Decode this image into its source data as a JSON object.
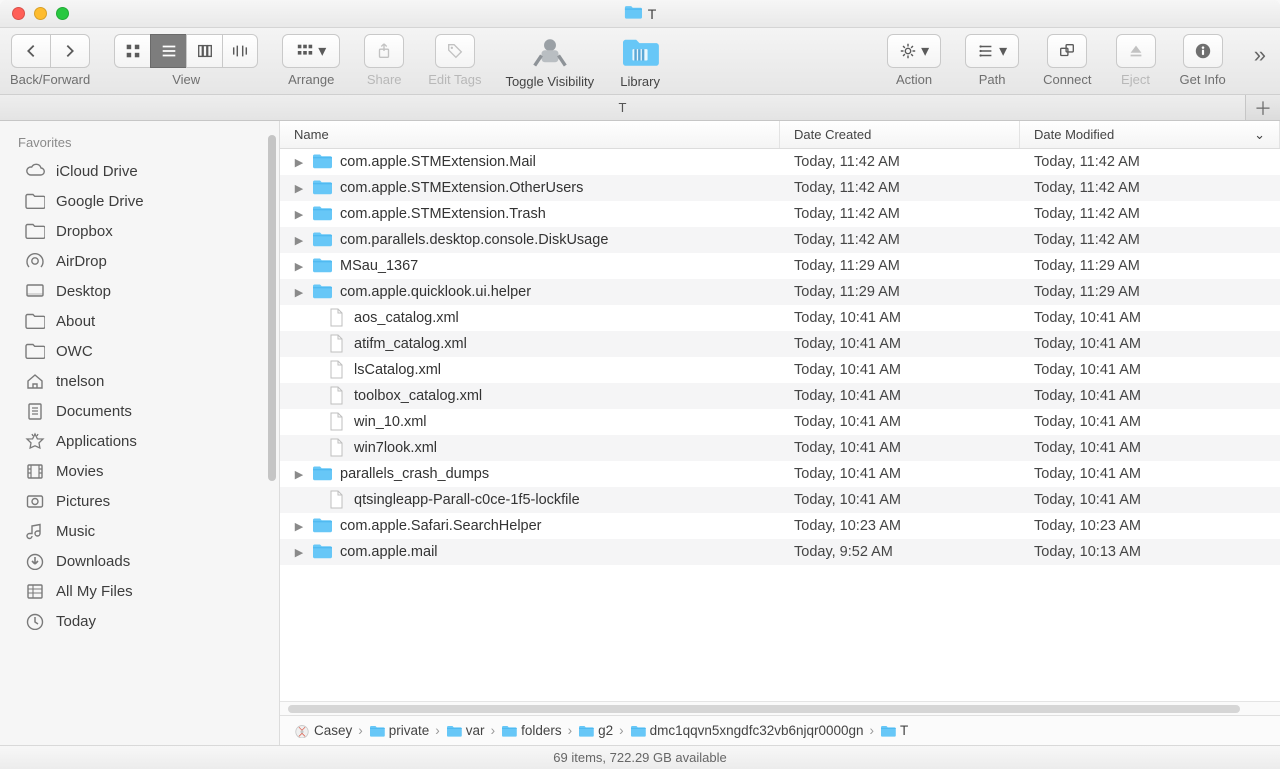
{
  "window": {
    "title": "T"
  },
  "toolbar": {
    "backforward": "Back/Forward",
    "view": "View",
    "arrange": "Arrange",
    "share": "Share",
    "edittags": "Edit Tags",
    "togglevis": "Toggle Visibility",
    "library": "Library",
    "action": "Action",
    "path": "Path",
    "connect": "Connect",
    "eject": "Eject",
    "getinfo": "Get Info"
  },
  "tabs": {
    "active": "T"
  },
  "sidebar": {
    "header": "Favorites",
    "items": [
      {
        "icon": "cloud",
        "label": "iCloud Drive"
      },
      {
        "icon": "folder",
        "label": "Google Drive"
      },
      {
        "icon": "folder",
        "label": "Dropbox"
      },
      {
        "icon": "airdrop",
        "label": "AirDrop"
      },
      {
        "icon": "desktop",
        "label": "Desktop"
      },
      {
        "icon": "folder",
        "label": "About"
      },
      {
        "icon": "folder",
        "label": "OWC"
      },
      {
        "icon": "home",
        "label": "tnelson"
      },
      {
        "icon": "doc",
        "label": "Documents"
      },
      {
        "icon": "apps",
        "label": "Applications"
      },
      {
        "icon": "movies",
        "label": "Movies"
      },
      {
        "icon": "pictures",
        "label": "Pictures"
      },
      {
        "icon": "music",
        "label": "Music"
      },
      {
        "icon": "downloads",
        "label": "Downloads"
      },
      {
        "icon": "allmyfiles",
        "label": "All My Files"
      },
      {
        "icon": "clock",
        "label": "Today"
      }
    ]
  },
  "columns": {
    "name": "Name",
    "created": "Date Created",
    "modified": "Date Modified"
  },
  "files": [
    {
      "kind": "folder",
      "name": "com.apple.STMExtension.Mail",
      "created": "Today, 11:42 AM",
      "modified": "Today, 11:42 AM",
      "exp": true
    },
    {
      "kind": "folder",
      "name": "com.apple.STMExtension.OtherUsers",
      "created": "Today, 11:42 AM",
      "modified": "Today, 11:42 AM",
      "exp": true
    },
    {
      "kind": "folder",
      "name": "com.apple.STMExtension.Trash",
      "created": "Today, 11:42 AM",
      "modified": "Today, 11:42 AM",
      "exp": true
    },
    {
      "kind": "folder",
      "name": "com.parallels.desktop.console.DiskUsage",
      "created": "Today, 11:42 AM",
      "modified": "Today, 11:42 AM",
      "exp": true
    },
    {
      "kind": "folder",
      "name": "MSau_1367",
      "created": "Today, 11:29 AM",
      "modified": "Today, 11:29 AM",
      "exp": true
    },
    {
      "kind": "folder",
      "name": "com.apple.quicklook.ui.helper",
      "created": "Today, 11:29 AM",
      "modified": "Today, 11:29 AM",
      "exp": true
    },
    {
      "kind": "file",
      "name": "aos_catalog.xml",
      "created": "Today, 10:41 AM",
      "modified": "Today, 10:41 AM",
      "exp": false
    },
    {
      "kind": "file",
      "name": "atifm_catalog.xml",
      "created": "Today, 10:41 AM",
      "modified": "Today, 10:41 AM",
      "exp": false
    },
    {
      "kind": "file",
      "name": "lsCatalog.xml",
      "created": "Today, 10:41 AM",
      "modified": "Today, 10:41 AM",
      "exp": false
    },
    {
      "kind": "file",
      "name": "toolbox_catalog.xml",
      "created": "Today, 10:41 AM",
      "modified": "Today, 10:41 AM",
      "exp": false
    },
    {
      "kind": "file",
      "name": "win_10.xml",
      "created": "Today, 10:41 AM",
      "modified": "Today, 10:41 AM",
      "exp": false
    },
    {
      "kind": "file",
      "name": "win7look.xml",
      "created": "Today, 10:41 AM",
      "modified": "Today, 10:41 AM",
      "exp": false
    },
    {
      "kind": "folder",
      "name": "parallels_crash_dumps",
      "created": "Today, 10:41 AM",
      "modified": "Today, 10:41 AM",
      "exp": true
    },
    {
      "kind": "file",
      "name": "qtsingleapp-Parall-c0ce-1f5-lockfile",
      "created": "Today, 10:41 AM",
      "modified": "Today, 10:41 AM",
      "exp": false
    },
    {
      "kind": "folder",
      "name": "com.apple.Safari.SearchHelper",
      "created": "Today, 10:23 AM",
      "modified": "Today, 10:23 AM",
      "exp": true
    },
    {
      "kind": "folder",
      "name": "com.apple.mail",
      "created": "Today, 9:52 AM",
      "modified": "Today, 10:13 AM",
      "exp": true
    }
  ],
  "path": [
    {
      "icon": "disk",
      "label": "Casey"
    },
    {
      "icon": "folder",
      "label": "private"
    },
    {
      "icon": "folder",
      "label": "var"
    },
    {
      "icon": "folder",
      "label": "folders"
    },
    {
      "icon": "folder",
      "label": "g2"
    },
    {
      "icon": "folder",
      "label": "dmc1qqvn5xngdfc32vb6njqr0000gn"
    },
    {
      "icon": "folder",
      "label": "T"
    }
  ],
  "status": "69 items, 722.29 GB available"
}
